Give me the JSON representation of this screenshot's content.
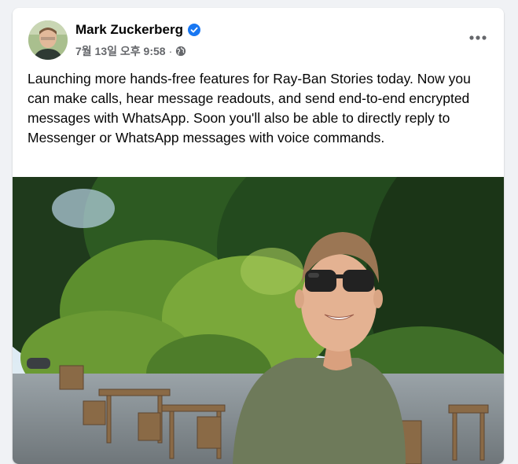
{
  "post": {
    "author": "Mark Zuckerberg",
    "timestamp": "7월 13일 오후 9:58",
    "separator": "·",
    "body": "Launching more hands-free features for Ray-Ban Stories today. Now you can make calls, hear message readouts, and send end-to-end encrypted messages with WhatsApp. Soon you'll also be able to directly reply to Messenger or WhatsApp messages with voice commands.",
    "icons": {
      "verified": "verified-badge-icon",
      "audience": "globe-icon",
      "more": "more-options-icon"
    }
  },
  "colors": {
    "page_bg": "#f0f2f5",
    "card_bg": "#ffffff",
    "text_primary": "#050505",
    "text_secondary": "#65676b",
    "verified_blue": "#1877f2"
  }
}
